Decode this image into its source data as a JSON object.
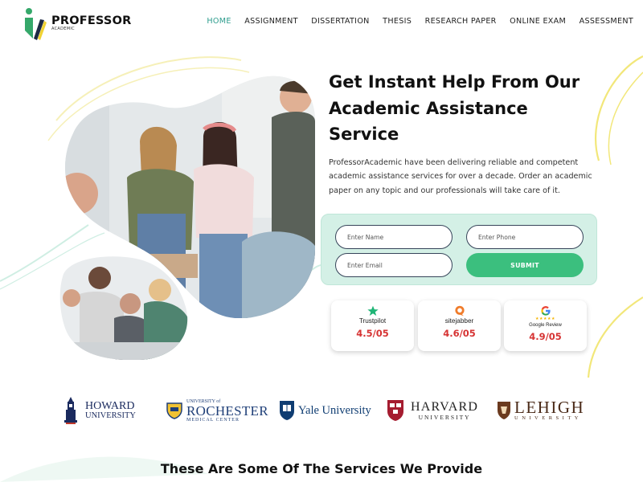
{
  "brand": {
    "title": "PROFESSOR",
    "subtitle": "ACADEMIC"
  },
  "nav": [
    {
      "label": "HOME",
      "active": true
    },
    {
      "label": "ASSIGNMENT"
    },
    {
      "label": "DISSERTATION"
    },
    {
      "label": "THESIS"
    },
    {
      "label": "RESEARCH PAPER"
    },
    {
      "label": "ONLINE EXAM"
    },
    {
      "label": "ASSESSMENT"
    }
  ],
  "hero": {
    "title": "Get Instant Help From Our Academic Assistance Service",
    "description": "ProfessorAcademic have been delivering reliable and competent academic assistance services for over a decade. Order an academic paper on any topic and our professionals will take care of it."
  },
  "form": {
    "name_placeholder": "Enter Name",
    "phone_placeholder": "Enter Phone",
    "email_placeholder": "Enter Email",
    "submit_label": "SUBMIT"
  },
  "ratings": [
    {
      "brand": "Trustpilot",
      "score": "4.5/05",
      "icon": "trustpilot-star-icon"
    },
    {
      "brand": "sitejabber",
      "score": "4.6/05",
      "icon": "sitejabber-icon"
    },
    {
      "brand": "Google Review",
      "score": "4.9/05",
      "icon": "google-icon"
    }
  ],
  "universities": {
    "howard": {
      "line1": "HOWARD",
      "line2": "UNIVERSITY"
    },
    "rochester": {
      "line1": "UNIVERSITY of",
      "line2": "ROCHESTER",
      "line3": "MEDICAL CENTER"
    },
    "yale": {
      "line1": "Yale University"
    },
    "harvard": {
      "line1": "HARVARD",
      "line2": "UNIVERSITY"
    },
    "lehigh": {
      "line1": "LEHIGH",
      "line2": "UNIVERSITY"
    }
  },
  "services_heading": "These Are Some Of The Services We Provide",
  "colors": {
    "accent": "#2d9c8d",
    "submit": "#3bbf7e",
    "form_bg": "#d4f0e6",
    "score": "#d63333",
    "decor_yellow": "#f2e77a"
  }
}
